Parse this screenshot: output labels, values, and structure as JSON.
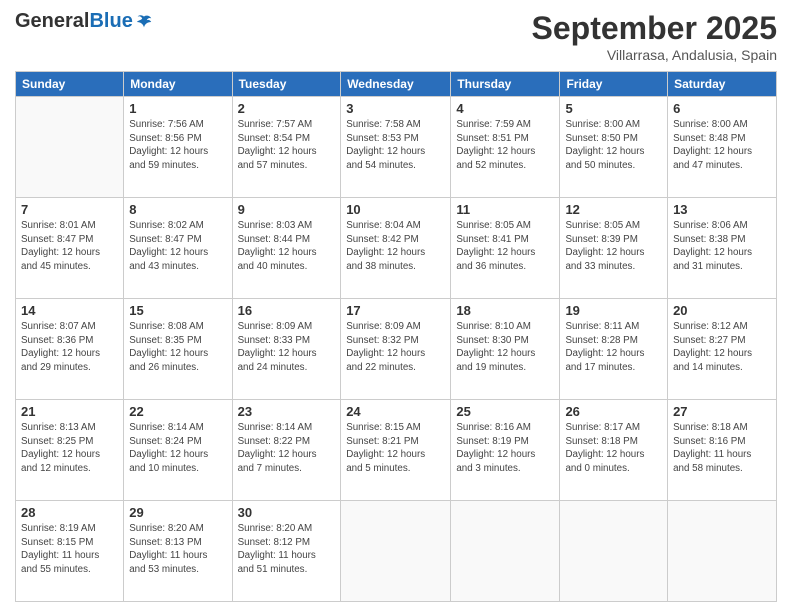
{
  "logo": {
    "general": "General",
    "blue": "Blue"
  },
  "header": {
    "month": "September 2025",
    "location": "Villarrasa, Andalusia, Spain"
  },
  "days_of_week": [
    "Sunday",
    "Monday",
    "Tuesday",
    "Wednesday",
    "Thursday",
    "Friday",
    "Saturday"
  ],
  "weeks": [
    [
      {
        "day": "",
        "info": ""
      },
      {
        "day": "1",
        "info": "Sunrise: 7:56 AM\nSunset: 8:56 PM\nDaylight: 12 hours\nand 59 minutes."
      },
      {
        "day": "2",
        "info": "Sunrise: 7:57 AM\nSunset: 8:54 PM\nDaylight: 12 hours\nand 57 minutes."
      },
      {
        "day": "3",
        "info": "Sunrise: 7:58 AM\nSunset: 8:53 PM\nDaylight: 12 hours\nand 54 minutes."
      },
      {
        "day": "4",
        "info": "Sunrise: 7:59 AM\nSunset: 8:51 PM\nDaylight: 12 hours\nand 52 minutes."
      },
      {
        "day": "5",
        "info": "Sunrise: 8:00 AM\nSunset: 8:50 PM\nDaylight: 12 hours\nand 50 minutes."
      },
      {
        "day": "6",
        "info": "Sunrise: 8:00 AM\nSunset: 8:48 PM\nDaylight: 12 hours\nand 47 minutes."
      }
    ],
    [
      {
        "day": "7",
        "info": ""
      },
      {
        "day": "8",
        "info": "Sunrise: 8:02 AM\nSunset: 8:47 PM\nDaylight: 12 hours\nand 43 minutes."
      },
      {
        "day": "9",
        "info": "Sunrise: 8:03 AM\nSunset: 8:44 PM\nDaylight: 12 hours\nand 40 minutes."
      },
      {
        "day": "10",
        "info": "Sunrise: 8:04 AM\nSunset: 8:42 PM\nDaylight: 12 hours\nand 38 minutes."
      },
      {
        "day": "11",
        "info": "Sunrise: 8:05 AM\nSunset: 8:41 PM\nDaylight: 12 hours\nand 36 minutes."
      },
      {
        "day": "12",
        "info": "Sunrise: 8:05 AM\nSunset: 8:39 PM\nDaylight: 12 hours\nand 33 minutes."
      },
      {
        "day": "13",
        "info": "Sunrise: 8:06 AM\nSunset: 8:38 PM\nDaylight: 12 hours\nand 31 minutes."
      }
    ],
    [
      {
        "day": "14",
        "info": ""
      },
      {
        "day": "15",
        "info": "Sunrise: 8:08 AM\nSunset: 8:35 PM\nDaylight: 12 hours\nand 26 minutes."
      },
      {
        "day": "16",
        "info": "Sunrise: 8:09 AM\nSunset: 8:33 PM\nDaylight: 12 hours\nand 24 minutes."
      },
      {
        "day": "17",
        "info": "Sunrise: 8:09 AM\nSunset: 8:32 PM\nDaylight: 12 hours\nand 22 minutes."
      },
      {
        "day": "18",
        "info": "Sunrise: 8:10 AM\nSunset: 8:30 PM\nDaylight: 12 hours\nand 19 minutes."
      },
      {
        "day": "19",
        "info": "Sunrise: 8:11 AM\nSunset: 8:28 PM\nDaylight: 12 hours\nand 17 minutes."
      },
      {
        "day": "20",
        "info": "Sunrise: 8:12 AM\nSunset: 8:27 PM\nDaylight: 12 hours\nand 14 minutes."
      }
    ],
    [
      {
        "day": "21",
        "info": ""
      },
      {
        "day": "22",
        "info": "Sunrise: 8:14 AM\nSunset: 8:24 PM\nDaylight: 12 hours\nand 10 minutes."
      },
      {
        "day": "23",
        "info": "Sunrise: 8:14 AM\nSunset: 8:22 PM\nDaylight: 12 hours\nand 7 minutes."
      },
      {
        "day": "24",
        "info": "Sunrise: 8:15 AM\nSunset: 8:21 PM\nDaylight: 12 hours\nand 5 minutes."
      },
      {
        "day": "25",
        "info": "Sunrise: 8:16 AM\nSunset: 8:19 PM\nDaylight: 12 hours\nand 3 minutes."
      },
      {
        "day": "26",
        "info": "Sunrise: 8:17 AM\nSunset: 8:18 PM\nDaylight: 12 hours\nand 0 minutes."
      },
      {
        "day": "27",
        "info": "Sunrise: 8:18 AM\nSunset: 8:16 PM\nDaylight: 11 hours\nand 58 minutes."
      }
    ],
    [
      {
        "day": "28",
        "info": "Sunrise: 8:19 AM\nSunset: 8:15 PM\nDaylight: 11 hours\nand 55 minutes."
      },
      {
        "day": "29",
        "info": "Sunrise: 8:20 AM\nSunset: 8:13 PM\nDaylight: 11 hours\nand 53 minutes."
      },
      {
        "day": "30",
        "info": "Sunrise: 8:20 AM\nSunset: 8:12 PM\nDaylight: 11 hours\nand 51 minutes."
      },
      {
        "day": "",
        "info": ""
      },
      {
        "day": "",
        "info": ""
      },
      {
        "day": "",
        "info": ""
      },
      {
        "day": "",
        "info": ""
      }
    ]
  ],
  "week7_sunday": "Sunrise: 8:01 AM\nSunset: 8:47 PM\nDaylight: 12 hours\nand 45 minutes.",
  "week14_sunday": "Sunrise: 8:07 AM\nSunset: 8:36 PM\nDaylight: 12 hours\nand 29 minutes.",
  "week21_sunday": "Sunrise: 8:13 AM\nSunset: 8:25 PM\nDaylight: 12 hours\nand 12 minutes."
}
